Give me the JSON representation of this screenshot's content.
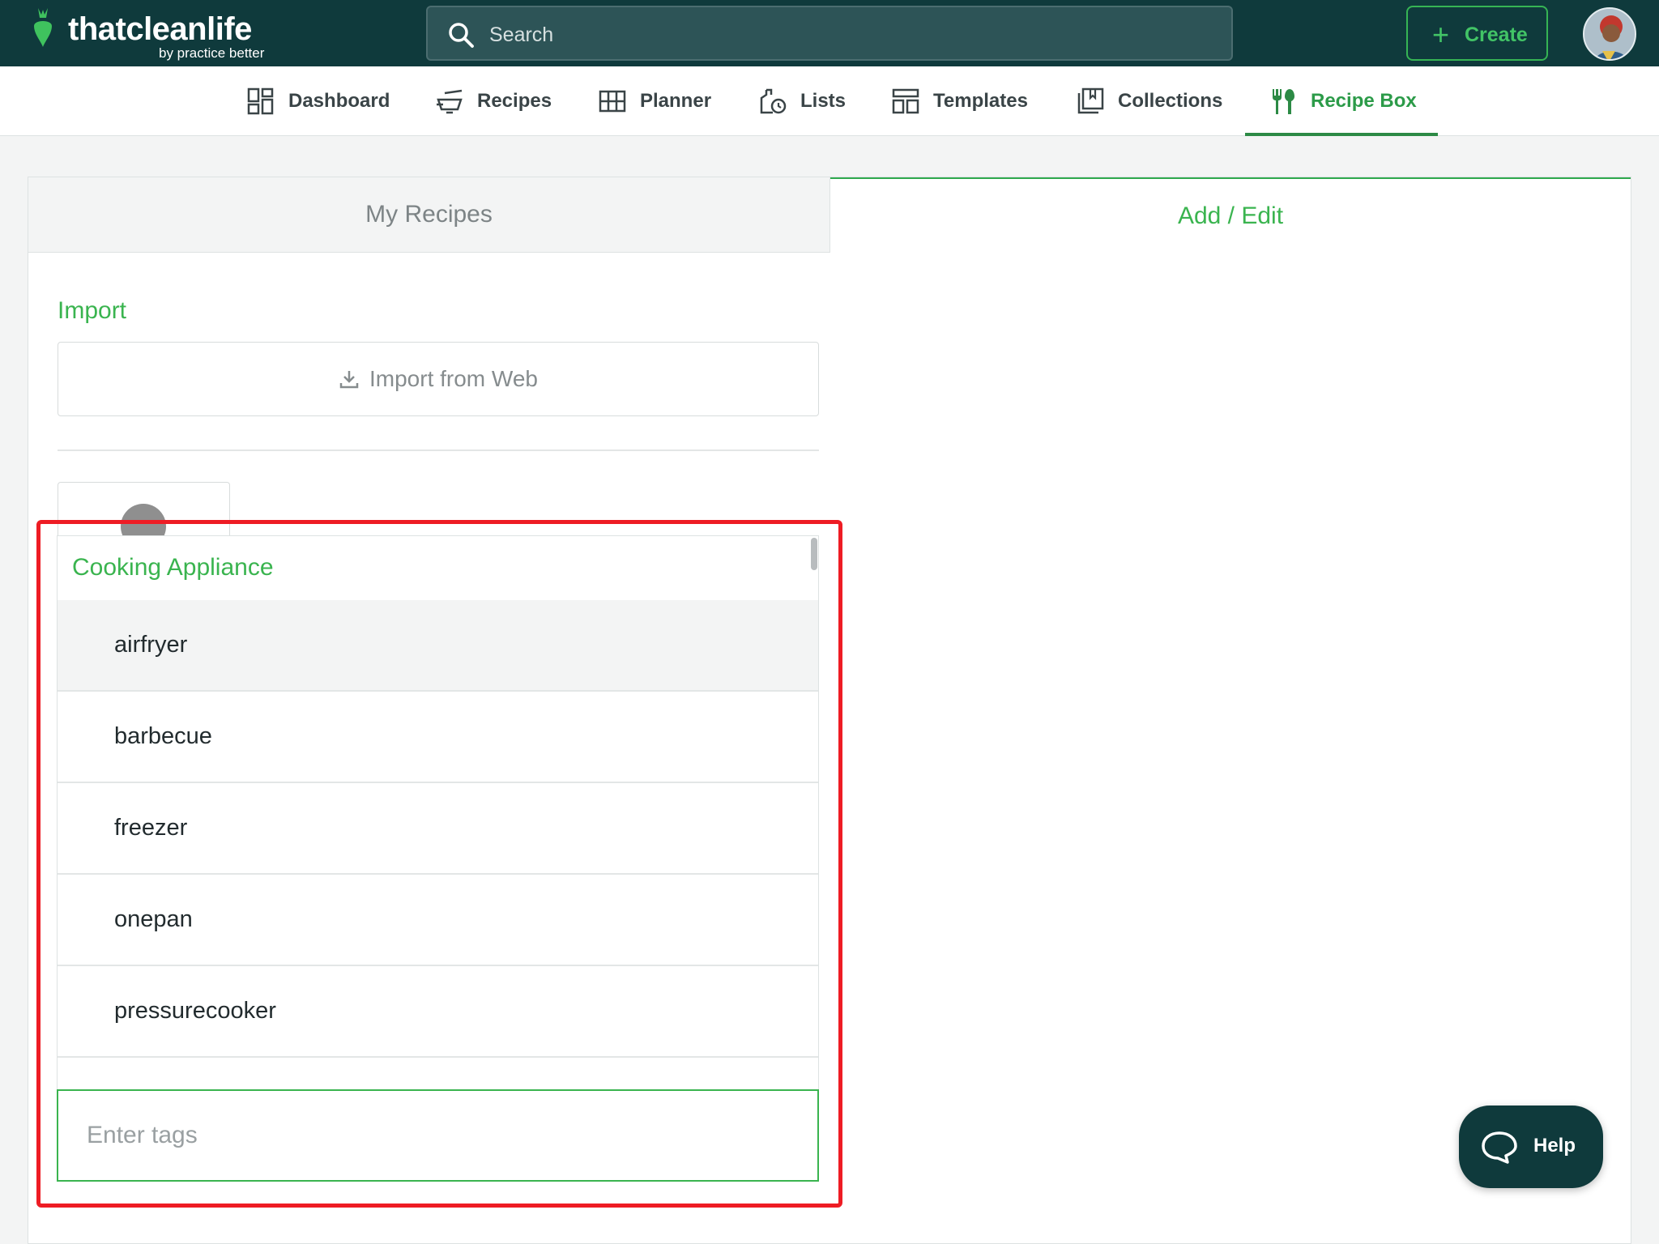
{
  "header": {
    "logo_text": "thatcleanlife",
    "logo_sub": "by practice better",
    "search_placeholder": "Search",
    "create_label": "Create"
  },
  "nav": {
    "items": [
      {
        "label": "Dashboard",
        "icon": "dashboard-icon"
      },
      {
        "label": "Recipes",
        "icon": "recipes-icon"
      },
      {
        "label": "Planner",
        "icon": "planner-icon"
      },
      {
        "label": "Lists",
        "icon": "lists-icon"
      },
      {
        "label": "Templates",
        "icon": "templates-icon"
      },
      {
        "label": "Collections",
        "icon": "collections-icon"
      },
      {
        "label": "Recipe Box",
        "icon": "fork-spoon-icon"
      }
    ],
    "active": "Recipe Box"
  },
  "tabs": {
    "my_recipes": "My Recipes",
    "add_edit": "Add / Edit",
    "active": "Add / Edit"
  },
  "import": {
    "title": "Import",
    "button_label": "Import from Web"
  },
  "tag_dropdown": {
    "group_label": "Cooking Appliance",
    "options": [
      "airfryer",
      "barbecue",
      "freezer",
      "onepan",
      "pressurecooker"
    ],
    "highlighted": "airfryer",
    "input_placeholder": "Enter tags"
  },
  "help": {
    "label": "Help"
  },
  "colors": {
    "header_bg": "#0f3a3c",
    "accent_green": "#3ab44f",
    "highlight_red": "#ee1c24"
  }
}
